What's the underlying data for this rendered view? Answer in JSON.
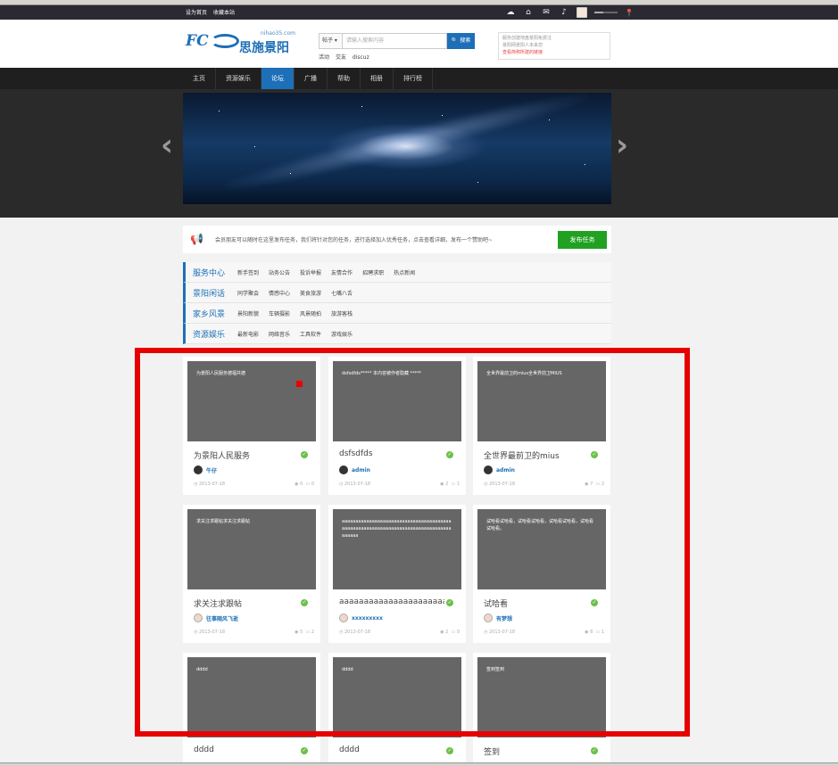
{
  "topbar": {
    "links": [
      "设为首页",
      "收藏本站"
    ],
    "volume_level": 0.4
  },
  "header": {
    "logo_domain": "nihao35.com",
    "logo_name": "思施景阳",
    "search": {
      "scope": "帖子",
      "placeholder": "请输入搜索内容",
      "button": "搜索"
    },
    "hotwords": [
      "活动",
      "交友",
      "discuz"
    ],
    "notice_lines": [
      "服务创建地盘景阳免费注",
      "景阳网景阳人未来您",
      "查看简称所建的链接"
    ]
  },
  "nav": {
    "items": [
      "主页",
      "资源娱乐",
      "论坛",
      "广播",
      "帮助",
      "相册",
      "排行榜"
    ],
    "active": "论坛"
  },
  "announcement": {
    "text": "会员朋友可以随时在这里发布任务，我们将针对您的任务，进行选择加入优秀任务，点击查看详细，发布一个赞助吧~",
    "publish_button": "发布任务"
  },
  "categories": [
    {
      "title": "服务中心",
      "links": [
        "新手签到",
        "站务公告",
        "投诉举报",
        "友情合作",
        "招聘求职",
        "热点新闻"
      ]
    },
    {
      "title": "景阳闲话",
      "links": [
        "同学聚会",
        "情感中心",
        "美食旅游",
        "七嘴八舌"
      ]
    },
    {
      "title": "家乡风景",
      "links": [
        "景阳新貌",
        "车辆摄影",
        "风景随拍",
        "旅游客栈"
      ]
    },
    {
      "title": "资源娱乐",
      "links": [
        "最新电影",
        "网络音乐",
        "工具软件",
        "游戏娱乐"
      ]
    }
  ],
  "posts": [
    {
      "caption": "为景阳人民服务德福共德",
      "title": "为景阳人民服务",
      "author": "牛仔",
      "date": "2013-07-18",
      "views": "0",
      "replies": "0",
      "red_dot": true,
      "avatar": "dark"
    },
    {
      "caption": "dsfsdfds***** 本内容被作者隐藏 *****",
      "title": "dsfsdfds",
      "author": "admin",
      "date": "2013-07-18",
      "views": "2",
      "replies": "1",
      "red_dot": false,
      "avatar": "dark"
    },
    {
      "caption": "全世界最前卫的mius全世界前卫MIUS",
      "title": "全世界最前卫的mius",
      "author": "admin",
      "date": "2013-07-18",
      "views": "7",
      "replies": "2",
      "red_dot": false,
      "avatar": "dark"
    },
    {
      "caption": "求关注求跟帖求关注求跟帖",
      "title": "求关注求跟帖",
      "author": "往事随风飞逝",
      "date": "2013-07-18",
      "views": "5",
      "replies": "2",
      "red_dot": false,
      "avatar": "light"
    },
    {
      "caption": "aaaaaaaaaaaaaaaaaaaaaaaaaaaaaaaaaaaaaaaaaaaaaaaaaaaaaaaaaaaaaaaaaaaaaaaaaaaaaaaaaaaaaa",
      "title": "aaaaaaaaaaaaaaaaaaaaaaaaaa",
      "author": "xxxxxxxxx",
      "date": "2013-07-18",
      "views": "2",
      "replies": "0",
      "red_dot": false,
      "avatar": "light"
    },
    {
      "caption": "试哈看试哈看，试哈看试哈看，试哈看试哈看，试哈看试哈看。",
      "title": "试哈看",
      "author": "有梦想",
      "date": "2013-07-18",
      "views": "8",
      "replies": "1",
      "red_dot": false,
      "avatar": "light"
    },
    {
      "caption": "dddd",
      "title": "dddd",
      "author": "",
      "date": "",
      "views": "",
      "replies": "",
      "red_dot": false,
      "avatar": "dark"
    },
    {
      "caption": "dddd",
      "title": "dddd",
      "author": "",
      "date": "",
      "views": "",
      "replies": "",
      "red_dot": false,
      "avatar": "dark"
    },
    {
      "caption": "签到签到",
      "title": "签到",
      "author": "",
      "date": "",
      "views": "",
      "replies": "",
      "red_dot": false,
      "avatar": "dark"
    }
  ],
  "colors": {
    "brand_blue": "#1d6fb8",
    "highlight_red": "#e60000",
    "publish_green": "#21a121"
  }
}
